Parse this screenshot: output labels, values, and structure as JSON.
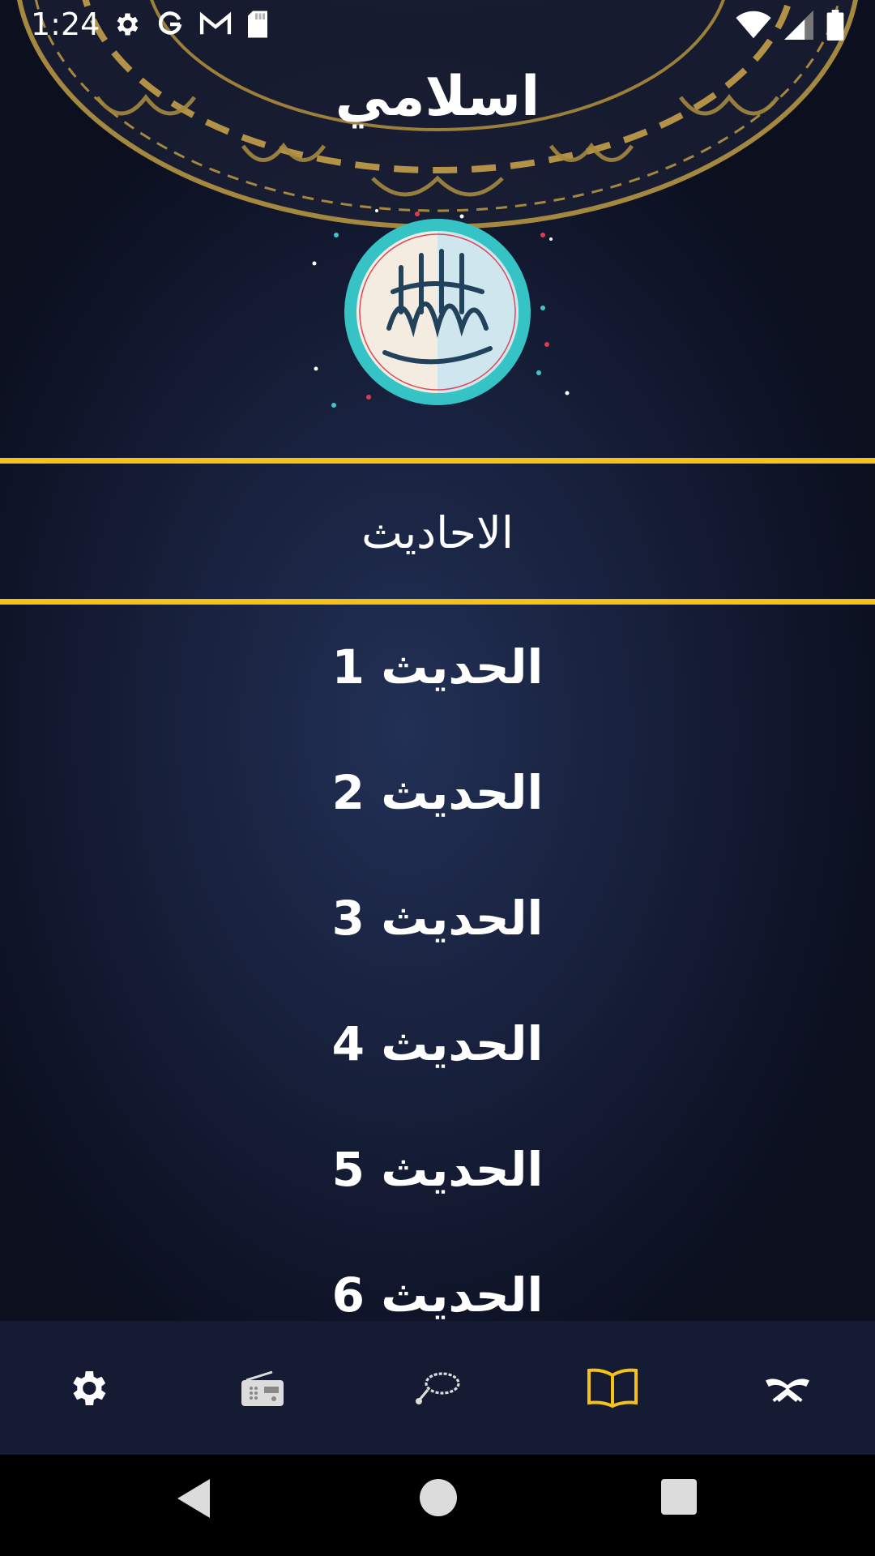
{
  "status_bar": {
    "time": "1:24",
    "icons_left": [
      "gear-icon",
      "google-icon",
      "gmail-icon",
      "sd-card-icon"
    ],
    "icons_right": [
      "wifi-icon",
      "signal-icon",
      "battery-icon"
    ]
  },
  "app": {
    "title": "اسلامي"
  },
  "section": {
    "title": "الاحاديث"
  },
  "hadith_list": [
    {
      "label": "الحديث 1"
    },
    {
      "label": "الحديث 2"
    },
    {
      "label": "الحديث 3"
    },
    {
      "label": "الحديث 4"
    },
    {
      "label": "الحديث 5"
    },
    {
      "label": "الحديث 6"
    }
  ],
  "bottom_nav": {
    "items": [
      {
        "icon": "settings-icon",
        "active": false
      },
      {
        "icon": "radio-icon",
        "active": false
      },
      {
        "icon": "tasbeeh-icon",
        "active": false
      },
      {
        "icon": "book-open-icon",
        "active": true
      },
      {
        "icon": "quran-icon",
        "active": false
      }
    ]
  },
  "colors": {
    "accent_gold": "#f6c21a",
    "background": "#18213d",
    "nav_background": "#141b33",
    "active_icon": "#f6c21a",
    "inactive_icon": "#ffffff"
  },
  "system_nav": [
    "back-icon",
    "home-icon",
    "recents-icon"
  ]
}
